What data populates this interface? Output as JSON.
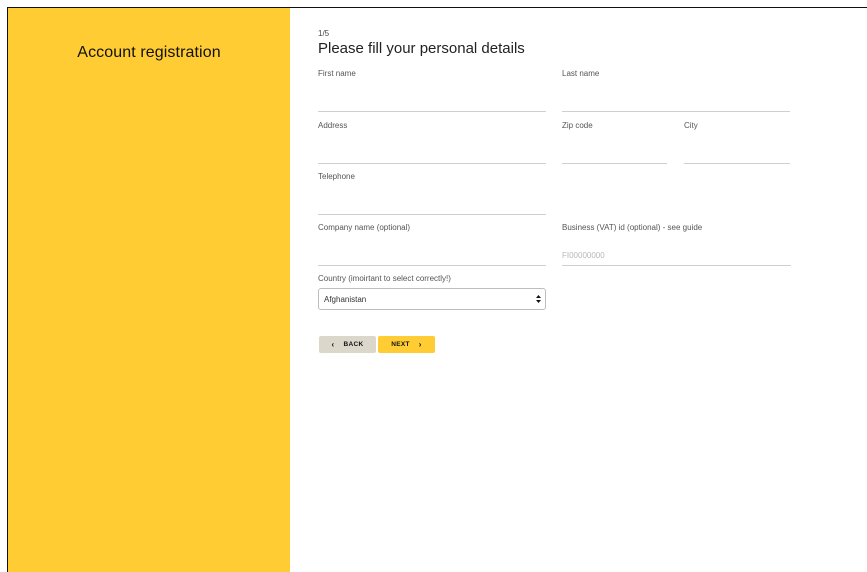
{
  "sidebar": {
    "title": "Account registration"
  },
  "form": {
    "step": "1/5",
    "heading": "Please fill your personal details",
    "fields": {
      "first_name": {
        "label": "First name",
        "value": "",
        "placeholder": ""
      },
      "last_name": {
        "label": "Last name",
        "value": "",
        "placeholder": ""
      },
      "address": {
        "label": "Address",
        "value": "",
        "placeholder": ""
      },
      "zip": {
        "label": "Zip code",
        "value": "",
        "placeholder": ""
      },
      "city": {
        "label": "City",
        "value": "",
        "placeholder": ""
      },
      "telephone": {
        "label": "Telephone",
        "value": "",
        "placeholder": ""
      },
      "company": {
        "label": "Company name (optional)",
        "value": "",
        "placeholder": ""
      },
      "vat": {
        "label": "Business (VAT) id (optional) - see guide",
        "value": "",
        "placeholder": "FI00000000"
      }
    },
    "country": {
      "label": "Country (imoirtant to select correctly!)",
      "selected": "Afghanistan"
    },
    "buttons": {
      "back": {
        "label": "BACK",
        "icon": "chevron-left-icon"
      },
      "next": {
        "label": "NEXT",
        "icon": "chevron-right-icon"
      }
    }
  },
  "colors": {
    "accent": "#ffcc33",
    "back_button": "#dcd7cb",
    "input_line": "#cfcfcf"
  }
}
